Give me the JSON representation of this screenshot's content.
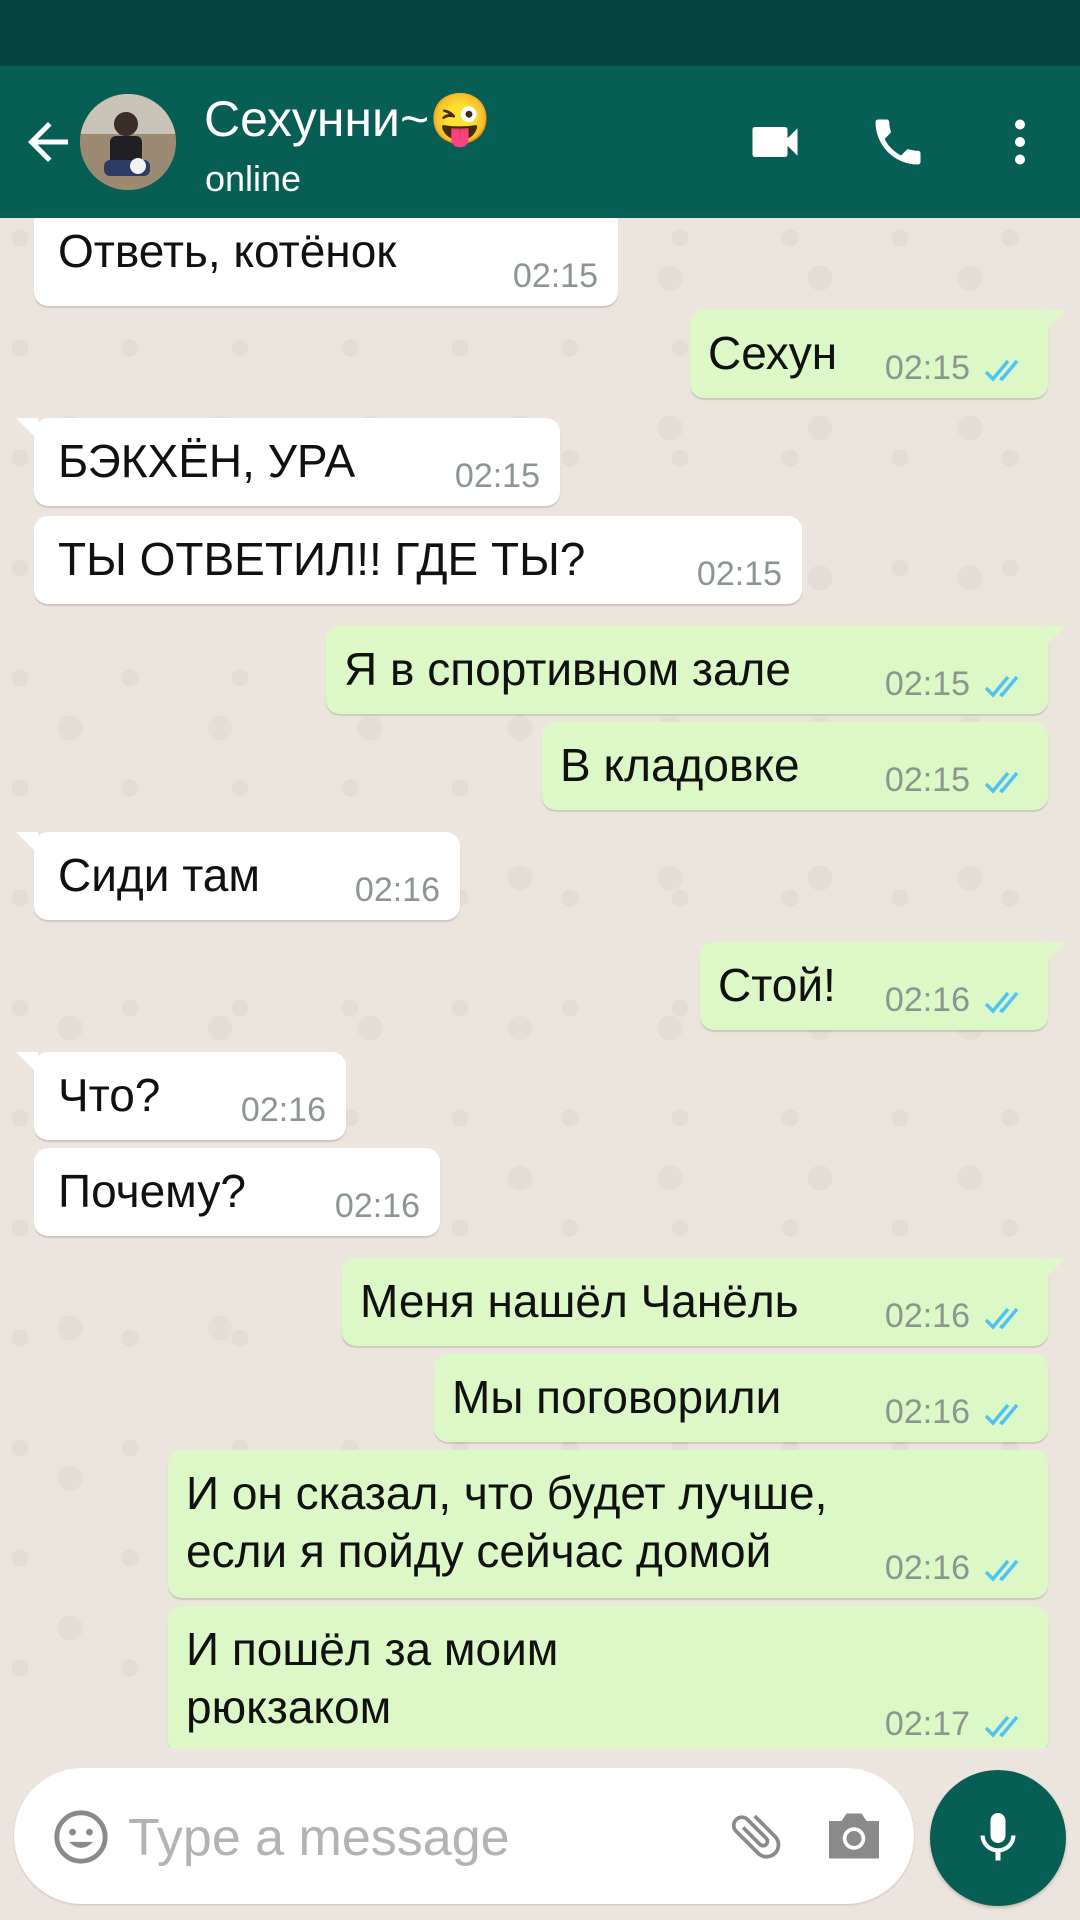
{
  "header": {
    "contact_name": "Сехунни~😜",
    "status": "online"
  },
  "icons": {
    "back": "arrow-left-icon",
    "video": "video-camera-icon",
    "call": "phone-icon",
    "menu": "more-vert-icon",
    "emoji": "emoji-icon",
    "attach": "paperclip-icon",
    "camera": "camera-icon",
    "mic": "microphone-icon",
    "read": "double-check-icon"
  },
  "colors": {
    "header": "#075e54",
    "status_bar": "#054740",
    "incoming_bubble": "#ffffff",
    "outgoing_bubble": "#dcf8c6",
    "read_ticks": "#4fc3f7",
    "chat_bg": "#ece5dd"
  },
  "messages": [
    {
      "dir": "in",
      "text": "Ответь, котёнок",
      "time": "02:15"
    },
    {
      "dir": "out",
      "text": "Сехун",
      "time": "02:15",
      "read": true
    },
    {
      "dir": "in",
      "text": "БЭКХЁН, УРА",
      "time": "02:15"
    },
    {
      "dir": "in",
      "text": "ТЫ ОТВЕТИЛ!! ГДЕ ТЫ?",
      "time": "02:15"
    },
    {
      "dir": "out",
      "text": "Я в спортивном зале",
      "time": "02:15",
      "read": true
    },
    {
      "dir": "out",
      "text": "В кладовке",
      "time": "02:15",
      "read": true
    },
    {
      "dir": "in",
      "text": "Сиди там",
      "time": "02:16"
    },
    {
      "dir": "out",
      "text": "Стой!",
      "time": "02:16",
      "read": true
    },
    {
      "dir": "in",
      "text": "Что?",
      "time": "02:16"
    },
    {
      "dir": "in",
      "text": "Почему?",
      "time": "02:16"
    },
    {
      "dir": "out",
      "text": "Меня нашёл Чанёль",
      "time": "02:16",
      "read": true
    },
    {
      "dir": "out",
      "text": "Мы поговорили",
      "time": "02:16",
      "read": true
    },
    {
      "dir": "out",
      "text": "И он сказал, что будет лучше,\nесли я пойду сейчас домой",
      "time": "02:16",
      "read": true
    },
    {
      "dir": "out",
      "text": "И пошёл за моим\nрюкзаком",
      "time": "02:17",
      "read": true
    }
  ],
  "composer": {
    "placeholder": "Type a message",
    "value": ""
  }
}
